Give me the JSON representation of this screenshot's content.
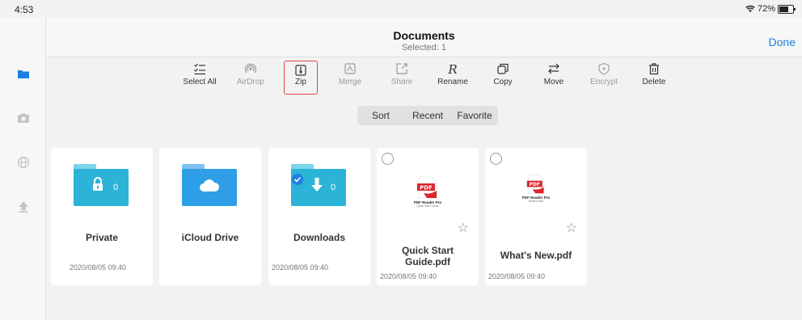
{
  "status": {
    "time": "4:53",
    "battery": "72%"
  },
  "header": {
    "title": "Documents",
    "subtitle": "Selected: 1",
    "done_label": "Done"
  },
  "toolbar": [
    {
      "label": "Select All",
      "icon": "select-all-icon"
    },
    {
      "label": "AirDrop",
      "icon": "airdrop-icon"
    },
    {
      "label": "Zip",
      "icon": "zip-icon"
    },
    {
      "label": "Merge",
      "icon": "merge-icon"
    },
    {
      "label": "Share",
      "icon": "share-icon"
    },
    {
      "label": "Rename",
      "icon": "rename-icon"
    },
    {
      "label": "Copy",
      "icon": "copy-icon"
    },
    {
      "label": "Move",
      "icon": "move-icon"
    },
    {
      "label": "Encrypt",
      "icon": "encrypt-icon"
    },
    {
      "label": "Delete",
      "icon": "trash-icon"
    }
  ],
  "segments": [
    "Sort",
    "Recent",
    "Favorite"
  ],
  "items": [
    {
      "name": "Private",
      "date": "2020/08/05 09:40",
      "count": "0",
      "kind": "folder"
    },
    {
      "name": "iCloud Drive",
      "kind": "folder"
    },
    {
      "name": "Downloads",
      "date": "2020/08/05 09:40",
      "count": "0",
      "kind": "folder",
      "selected": true
    },
    {
      "name": "Quick Start Guide.pdf",
      "date": "2020/08/05 09:40",
      "kind": "pdf",
      "thumb_title": "PDF Reader Pro",
      "thumb_sub": "Quick Start Guide"
    },
    {
      "name": "What's New.pdf",
      "date": "2020/08/05 09:40",
      "kind": "pdf",
      "thumb_title": "PDF Reader Pro",
      "thumb_sub": "What's New"
    }
  ],
  "colors": {
    "accent": "#1d7fe0",
    "folder": "#2bb3d8",
    "highlight": "#e0464b",
    "pdf_red": "#d9262c"
  }
}
